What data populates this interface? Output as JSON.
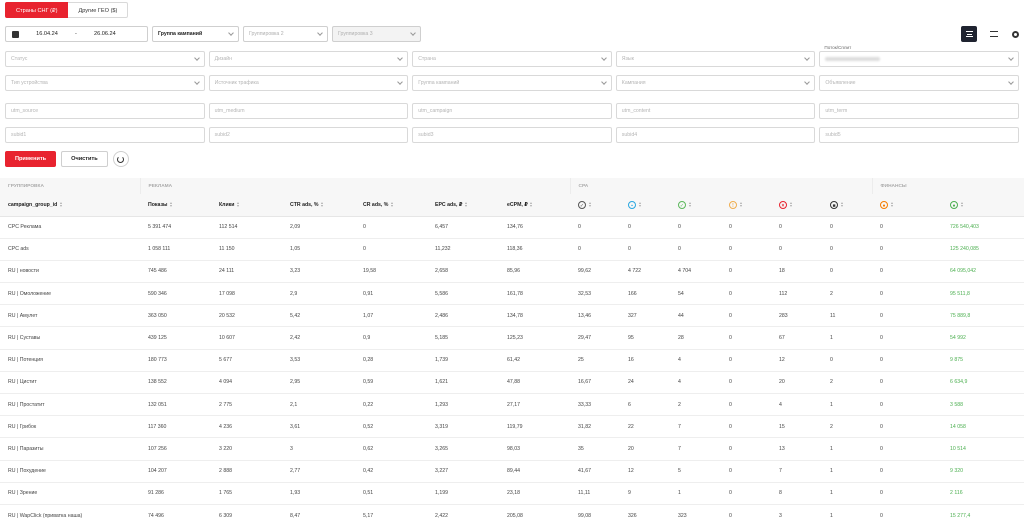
{
  "tabs": [
    {
      "label": "Страны СНГ (₽)"
    },
    {
      "label": "Другие ГЕО ($)"
    }
  ],
  "date": {
    "from": "16.04.24",
    "sep": "-",
    "to": "26.06.24"
  },
  "grouping": {
    "g1": "Группа кампаний",
    "g2": "Группировка 2",
    "g3": "Группировка 3"
  },
  "filters": {
    "row1": [
      "Статус",
      "Дизайн",
      "Страна",
      "Язык"
    ],
    "flow_label": "Поток/Сплит",
    "row2": [
      "Тип устройства",
      "Источник трафика",
      "Группа кампаний",
      "Кампания",
      "Объявление"
    ],
    "utm": [
      "utm_source",
      "utm_medium",
      "utm_campaign",
      "utm_content",
      "utm_term"
    ],
    "subid": [
      "subid1",
      "subid2",
      "subid3",
      "subid4",
      "subid5"
    ]
  },
  "actions": {
    "apply": "Применить",
    "clear": "Очистить"
  },
  "table": {
    "groups": {
      "grouping": "ГРУППИРОВКА",
      "ads": "РЕКЛАМА",
      "cpa": "CPA",
      "finance": "ФИНАНСЫ"
    },
    "columns": [
      "campaign_group_id",
      "Показы",
      "Клики",
      "CTR ads, %",
      "CR ads, %",
      "EPC ads, ₽",
      "eCPM, ₽"
    ],
    "cpa_icons": [
      {
        "icon": "check-circle-icon",
        "color": "#555555"
      },
      {
        "icon": "hold-icon",
        "color": "#2aa7e0"
      },
      {
        "icon": "approve-icon",
        "color": "#5cb85c"
      },
      {
        "icon": "pending-icon",
        "color": "#f0ad4e"
      },
      {
        "icon": "reject-icon",
        "color": "#e8232f"
      },
      {
        "icon": "trash-icon",
        "color": "#333333"
      }
    ],
    "fin_icons": [
      {
        "icon": "fire-icon",
        "color": "#f57c00"
      },
      {
        "icon": "money-icon",
        "color": "#4caf50"
      }
    ],
    "rows": [
      [
        "CPC Реклама",
        "5 391 474",
        "112 514",
        "2,09",
        "0",
        "6,457",
        "134,76",
        "0",
        "0",
        "0",
        "0",
        "0",
        "0",
        "0",
        "726 540,403"
      ],
      [
        "CPC ads",
        "1 058 111",
        "11 150",
        "1,05",
        "0",
        "11,232",
        "118,36",
        "0",
        "0",
        "0",
        "0",
        "0",
        "0",
        "0",
        "125 240,085"
      ],
      [
        "RU | новости",
        "745 486",
        "24 111",
        "3,23",
        "19,58",
        "2,658",
        "85,96",
        "99,62",
        "4 722",
        "4 704",
        "0",
        "18",
        "0",
        "0",
        "64 095,042"
      ],
      [
        "RU | Омоложение",
        "590 346",
        "17 098",
        "2,9",
        "0,91",
        "5,586",
        "161,78",
        "32,53",
        "166",
        "54",
        "0",
        "112",
        "2",
        "0",
        "95 511,8"
      ],
      [
        "RU | Амулет",
        "363 050",
        "20 532",
        "5,42",
        "1,07",
        "2,486",
        "134,78",
        "13,46",
        "327",
        "44",
        "0",
        "283",
        "11",
        "0",
        "75 889,8"
      ],
      [
        "RU | Суставы",
        "439 125",
        "10 607",
        "2,42",
        "0,9",
        "5,185",
        "125,23",
        "29,47",
        "95",
        "28",
        "0",
        "67",
        "1",
        "0",
        "54 992"
      ],
      [
        "RU | Потенция",
        "180 773",
        "5 677",
        "3,53",
        "0,28",
        "1,739",
        "61,42",
        "25",
        "16",
        "4",
        "0",
        "12",
        "0",
        "0",
        "9 875"
      ],
      [
        "RU | Цистит",
        "138 552",
        "4 094",
        "2,95",
        "0,59",
        "1,621",
        "47,88",
        "16,67",
        "24",
        "4",
        "0",
        "20",
        "2",
        "0",
        "6 634,9"
      ],
      [
        "RU | Простатит",
        "132 051",
        "2 775",
        "2,1",
        "0,22",
        "1,293",
        "27,17",
        "33,33",
        "6",
        "2",
        "0",
        "4",
        "1",
        "0",
        "3 588"
      ],
      [
        "RU | Грибок",
        "117 360",
        "4 236",
        "3,61",
        "0,52",
        "3,319",
        "119,79",
        "31,82",
        "22",
        "7",
        "0",
        "15",
        "2",
        "0",
        "14 058"
      ],
      [
        "RU | Паразиты",
        "107 256",
        "3 220",
        "3",
        "0,62",
        "3,265",
        "98,03",
        "35",
        "20",
        "7",
        "0",
        "13",
        "1",
        "0",
        "10 514"
      ],
      [
        "RU | Похудение",
        "104 207",
        "2 888",
        "2,77",
        "0,42",
        "3,227",
        "89,44",
        "41,67",
        "12",
        "5",
        "0",
        "7",
        "1",
        "0",
        "9 320"
      ],
      [
        "RU | Зрение",
        "91 286",
        "1 765",
        "1,93",
        "0,51",
        "1,199",
        "23,18",
        "11,11",
        "9",
        "1",
        "0",
        "8",
        "1",
        "0",
        "2 116"
      ],
      [
        "RU | WapClick (приватка наша)",
        "74 496",
        "6 309",
        "8,47",
        "5,17",
        "2,422",
        "205,08",
        "99,08",
        "326",
        "323",
        "0",
        "3",
        "1",
        "0",
        "15 277,4"
      ]
    ]
  }
}
